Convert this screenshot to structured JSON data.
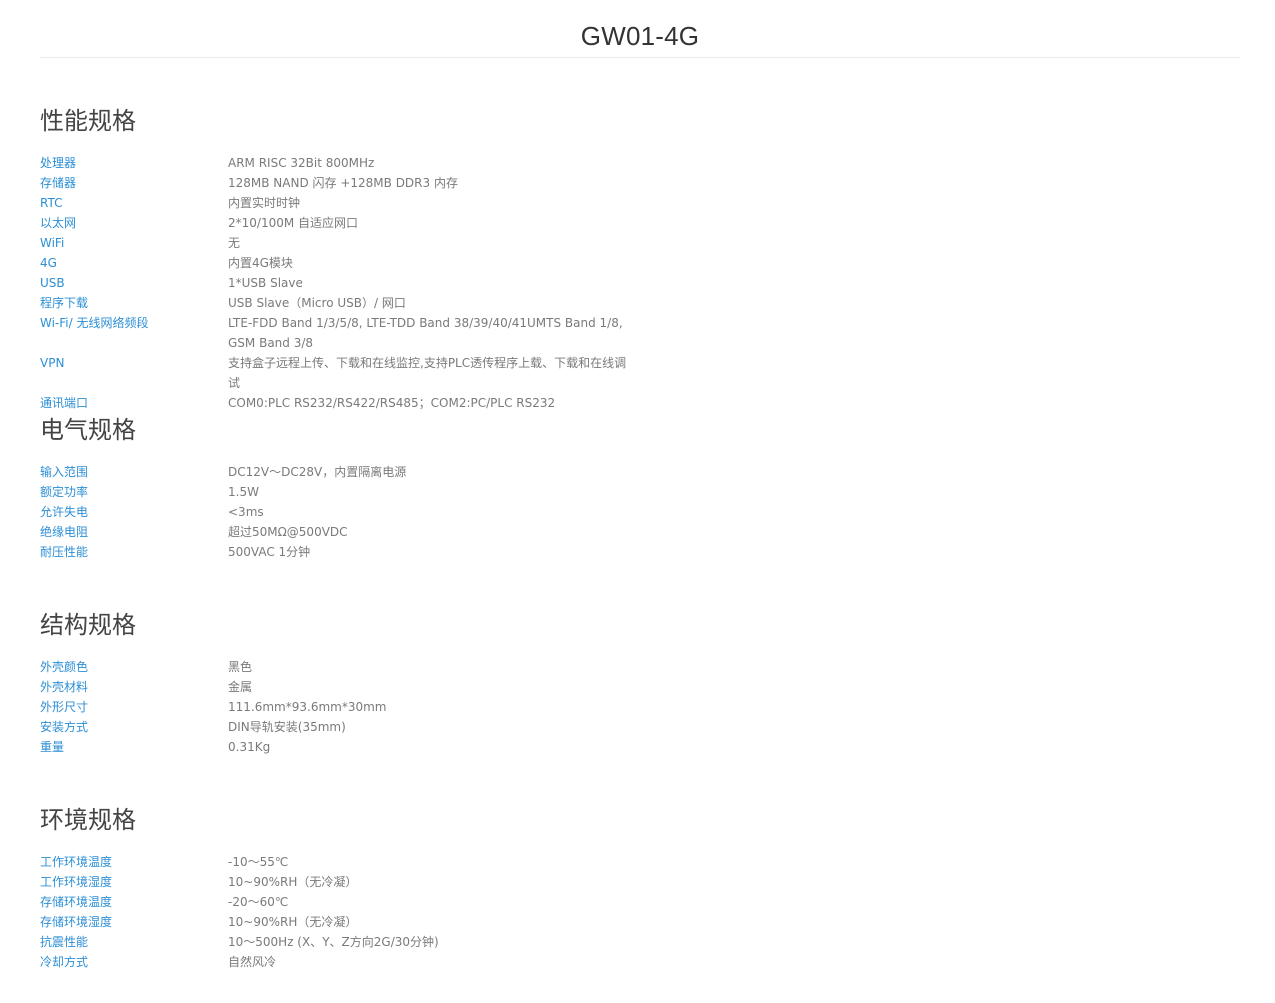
{
  "page": {
    "title": "GW01-4G"
  },
  "sections": [
    {
      "title": "性能规格",
      "rows": [
        {
          "label": "处理器",
          "value": "ARM RISC 32Bit 800MHz"
        },
        {
          "label": "存储器",
          "value": "128MB NAND 闪存 +128MB DDR3 内存"
        },
        {
          "label": "RTC",
          "value": "内置实时时钟"
        },
        {
          "label": "以太网",
          "value": "2*10/100M 自适应网口"
        },
        {
          "label": "WiFi",
          "value": "无"
        },
        {
          "label": "4G",
          "value": "内置4G模块"
        },
        {
          "label": "USB",
          "value": "1*USB Slave"
        },
        {
          "label": "程序下载",
          "value": "USB Slave（Micro USB）/ 网口"
        },
        {
          "label": "Wi-Fi/ 无线网络频段",
          "value": "LTE-FDD Band 1/3/5/8, LTE-TDD Band 38/39/40/41UMTS Band 1/8, GSM Band 3/8"
        },
        {
          "label": "VPN",
          "value": "支持盒子远程上传、下载和在线监控,支持PLC透传程序上载、下载和在线调试"
        },
        {
          "label": "通讯端口",
          "value": "COM0:PLC RS232/RS422/RS485；COM2:PC/PLC RS232"
        }
      ]
    },
    {
      "title": "电气规格",
      "rows": [
        {
          "label": "输入范围",
          "value": "DC12V～DC28V，内置隔离电源"
        },
        {
          "label": "额定功率",
          "value": "1.5W"
        },
        {
          "label": "允许失电",
          "value": "<3ms"
        },
        {
          "label": "绝缘电阻",
          "value": "超过50MΩ@500VDC"
        },
        {
          "label": "耐压性能",
          "value": "500VAC 1分钟"
        }
      ]
    },
    {
      "title": "结构规格",
      "rows": [
        {
          "label": "外壳颜色",
          "value": "黑色"
        },
        {
          "label": "外壳材料",
          "value": "金属"
        },
        {
          "label": "外形尺寸",
          "value": "111.6mm*93.6mm*30mm"
        },
        {
          "label": "安装方式",
          "value": "DIN导轨安装(35mm)"
        },
        {
          "label": "重量",
          "value": "0.31Kg"
        }
      ]
    },
    {
      "title": "环境规格",
      "rows": [
        {
          "label": "工作环境温度",
          "value": "-10～55℃"
        },
        {
          "label": "工作环境湿度",
          "value": "10~90%RH（无冷凝）"
        },
        {
          "label": "存储环境温度",
          "value": "-20～60℃"
        },
        {
          "label": "存储环境湿度",
          "value": "10~90%RH（无冷凝）"
        },
        {
          "label": "抗震性能",
          "value": "10～500Hz (X、Y、Z方向2G/30分钟)"
        },
        {
          "label": "冷却方式",
          "value": "自然风冷"
        }
      ]
    }
  ]
}
